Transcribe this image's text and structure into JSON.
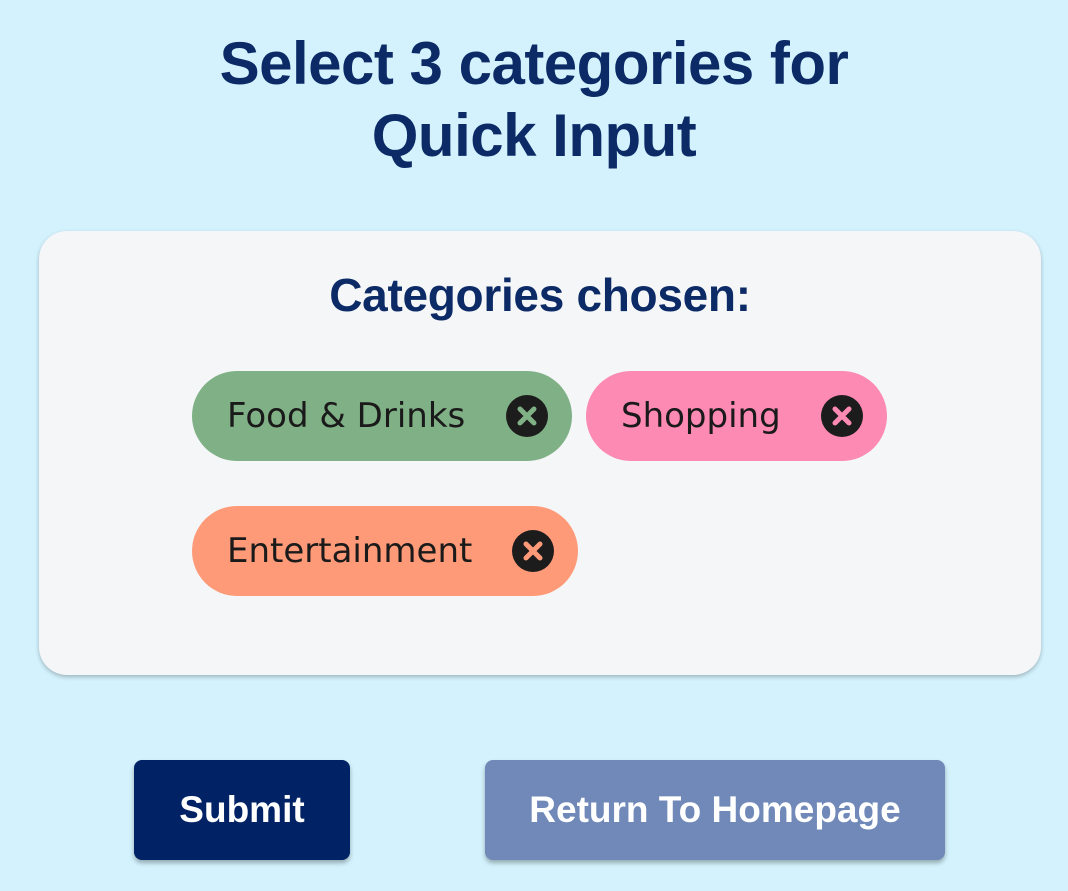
{
  "page": {
    "title_line1": "Select 3 categories for",
    "title_line2": "Quick Input"
  },
  "card": {
    "title": "Categories chosen:",
    "chips": [
      {
        "label": "Food & Drinks",
        "color": "#80b085",
        "icon": "close-circle-icon"
      },
      {
        "label": "Shopping",
        "color": "#fd8ab2",
        "icon": "close-circle-icon"
      },
      {
        "label": "Entertainment",
        "color": "#fe9a78",
        "icon": "close-circle-icon"
      }
    ]
  },
  "actions": {
    "submit_label": "Submit",
    "return_label": "Return To Homepage",
    "submit_color": "#012265",
    "return_color": "#7089b8"
  },
  "colors": {
    "background": "#d3f2fd",
    "title": "#0b2a66",
    "card": "#f4f6f8"
  }
}
